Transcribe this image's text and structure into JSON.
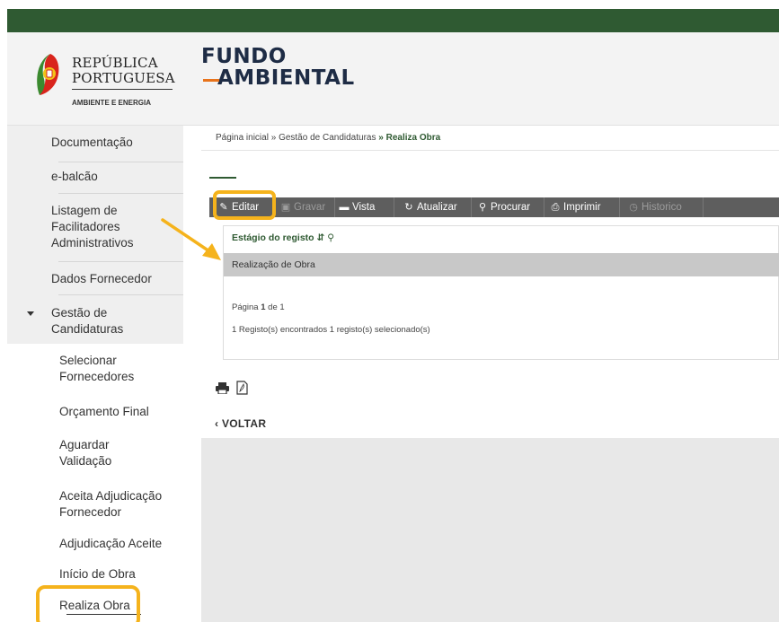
{
  "header": {
    "gov_name_line1": "REPÚBLICA",
    "gov_name_line2": "PORTUGUESA",
    "gov_subtitle": "AMBIENTE E ENERGIA",
    "fund_line1": "FUNDO",
    "fund_line2": "AMBIENTAL"
  },
  "sidebar": {
    "items": [
      {
        "label": "Documentação"
      },
      {
        "label": "e-balcão"
      },
      {
        "label_lines": [
          "Listagem de",
          "Facilitadores",
          "Administrativos"
        ]
      },
      {
        "label": "Dados Fornecedor"
      },
      {
        "label_lines": [
          "Gestão de",
          "Candidaturas"
        ]
      }
    ],
    "subitems": [
      {
        "label_lines": [
          "Selecionar",
          "Fornecedores"
        ]
      },
      {
        "label": "Orçamento Final"
      },
      {
        "label_lines": [
          "Aguardar",
          "Validação"
        ]
      },
      {
        "label_lines": [
          "Aceita Adjudicação",
          "Fornecedor"
        ]
      },
      {
        "label": "Adjudicação Aceite"
      },
      {
        "label": "Início de Obra"
      },
      {
        "label": "Realiza Obra"
      }
    ]
  },
  "breadcrumb": {
    "home": "Página inicial",
    "sep": "»",
    "section": "Gestão de Candidaturas",
    "current": "Realiza Obra"
  },
  "toolbar": {
    "editar": "Editar",
    "gravar": "Gravar",
    "vista": "Vista",
    "atualizar": "Atualizar",
    "procurar": "Procurar",
    "imprimir": "Imprimir",
    "historico": "Historico"
  },
  "grid": {
    "column_header": "Estágio do registo",
    "rows": [
      "Realização de Obra"
    ],
    "page_label": "Página",
    "page_current": "1",
    "page_of": "de 1",
    "records_text": "1 Registo(s) encontrados 1 registo(s) selecionado(s)"
  },
  "footer": {
    "back_label": "VOLTAR"
  },
  "colors": {
    "top_bar": "#2f5a32",
    "toolbar": "#5e5e5e",
    "highlight": "#f5b31c",
    "accent_orange": "#e8731b",
    "brand_navy": "#1e2c45"
  }
}
